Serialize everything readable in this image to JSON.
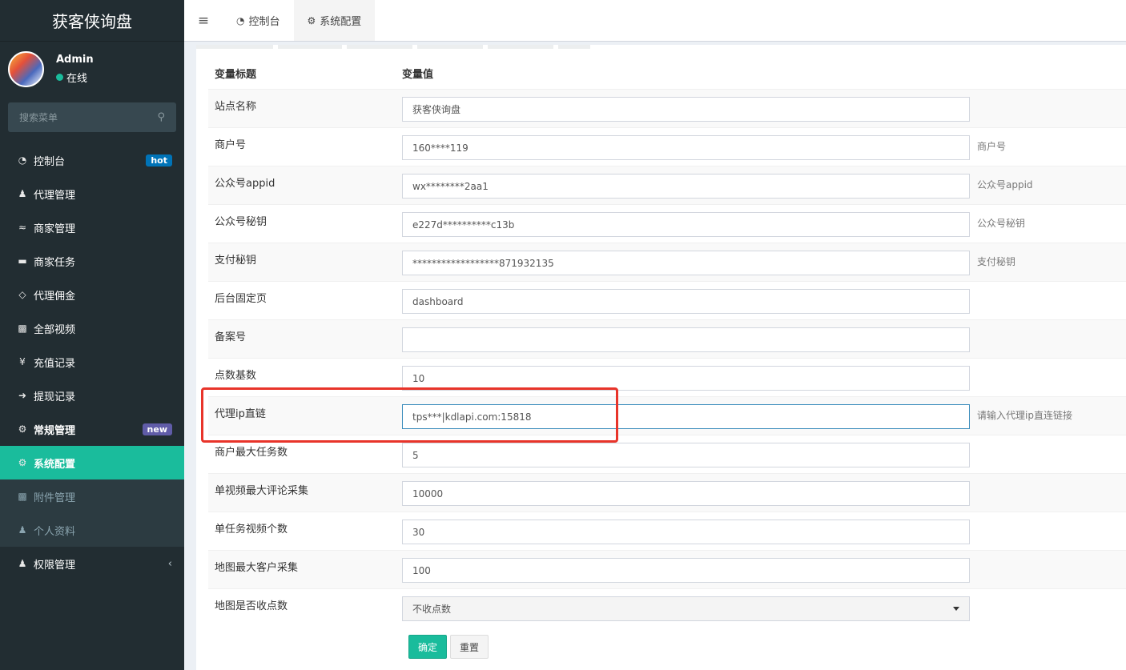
{
  "app": {
    "title": "获客侠询盘"
  },
  "user": {
    "name": "Admin",
    "status": "在线"
  },
  "search": {
    "placeholder": "搜索菜单"
  },
  "menu": [
    {
      "label": "控制台",
      "icon": "dashboard-icon",
      "badge": "hot"
    },
    {
      "label": "代理管理",
      "icon": "user-plus-icon"
    },
    {
      "label": "商家管理",
      "icon": "handshake-icon"
    },
    {
      "label": "商家任务",
      "icon": "keyboard-icon"
    },
    {
      "label": "代理佣金",
      "icon": "diamond-icon"
    },
    {
      "label": "全部视频",
      "icon": "file-image-icon"
    },
    {
      "label": "充值记录",
      "icon": "yen-icon"
    },
    {
      "label": "提现记录",
      "icon": "sign-in-icon"
    },
    {
      "label": "常规管理",
      "icon": "cogs-icon",
      "badge": "new"
    },
    {
      "label": "系统配置",
      "icon": "gear-icon"
    },
    {
      "label": "附件管理",
      "icon": "file-image-icon"
    },
    {
      "label": "个人资料",
      "icon": "user-icon"
    },
    {
      "label": "权限管理",
      "icon": "group-icon"
    }
  ],
  "tabs": [
    {
      "label": "控制台",
      "icon": "dashboard-icon"
    },
    {
      "label": "系统配置",
      "icon": "gear-icon"
    }
  ],
  "table": {
    "col_title": "变量标题",
    "col_value": "变量值",
    "rows": [
      {
        "title": "站点名称",
        "value": "获客侠询盘",
        "tip": ""
      },
      {
        "title": "商户号",
        "value": "160****119",
        "tip": "商户号"
      },
      {
        "title": "公众号appid",
        "value": "wx********2aa1",
        "tip": "公众号appid"
      },
      {
        "title": "公众号秘钥",
        "value": "e227d**********c13b",
        "tip": "公众号秘钥"
      },
      {
        "title": "支付秘钥",
        "value": "******************871932135",
        "tip": "支付秘钥"
      },
      {
        "title": "后台固定页",
        "value": "dashboard",
        "tip": ""
      },
      {
        "title": "备案号",
        "value": "",
        "tip": ""
      },
      {
        "title": "点数基数",
        "value": "10",
        "tip": ""
      },
      {
        "title": "代理ip直链",
        "value": "tps***|kdlapi.com:15818",
        "tip": "请输入代理ip直连链接"
      },
      {
        "title": "商户最大任务数",
        "value": "5",
        "tip": ""
      },
      {
        "title": "单视频最大评论采集",
        "value": "10000",
        "tip": ""
      },
      {
        "title": "单任务视频个数",
        "value": "30",
        "tip": ""
      },
      {
        "title": "地图最大客户采集",
        "value": "100",
        "tip": ""
      },
      {
        "title": "地图是否收点数",
        "value": "不收点数",
        "tip": ""
      }
    ]
  },
  "buttons": {
    "confirm": "确定",
    "reset": "重置"
  },
  "colors": {
    "sidebar": "#222d32",
    "accent": "#1abc9c",
    "highlight": "#e8342a"
  }
}
